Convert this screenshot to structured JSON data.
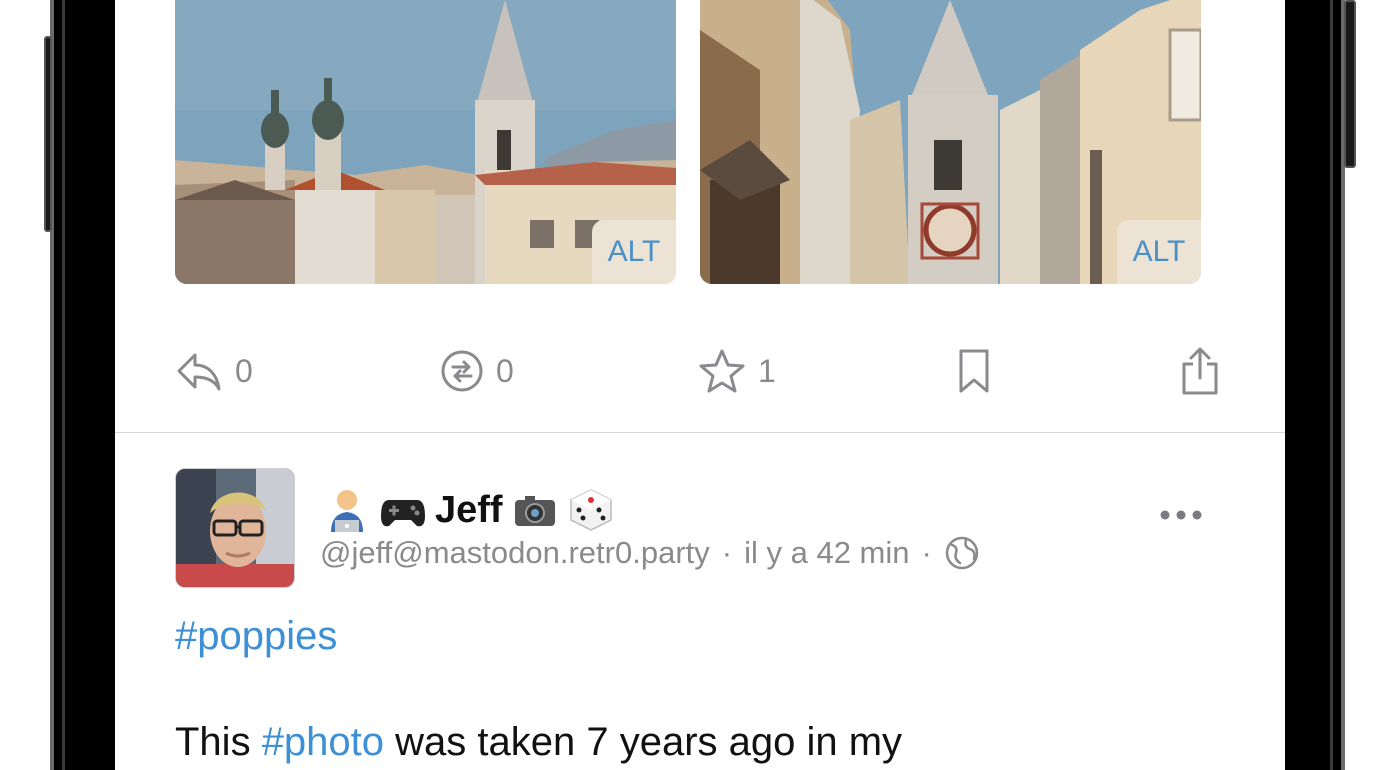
{
  "media": [
    {
      "alt_badge": "ALT"
    },
    {
      "alt_badge": "ALT"
    }
  ],
  "actions": {
    "reply_count": "0",
    "boost_count": "0",
    "favourite_count": "1"
  },
  "post": {
    "display_name": "Jeff",
    "handle": "@jeff@mastodon.retr0.party",
    "separator": "·",
    "time": "il y a 42 min",
    "hashtag": "#poppies",
    "body_prefix": "This ",
    "body_tag": "#photo",
    "body_rest": " was taken 7 years ago in my"
  },
  "icons": {
    "reply": "reply-arrow-icon",
    "boost": "boost-icon",
    "favourite": "star-icon",
    "bookmark": "bookmark-icon",
    "share": "share-icon",
    "visibility": "globe-icon",
    "more": "ellipsis-icon"
  },
  "colors": {
    "link": "#3d8fd6",
    "muted": "#8a8a8e",
    "alt_badge_bg": "#ece3d5"
  }
}
